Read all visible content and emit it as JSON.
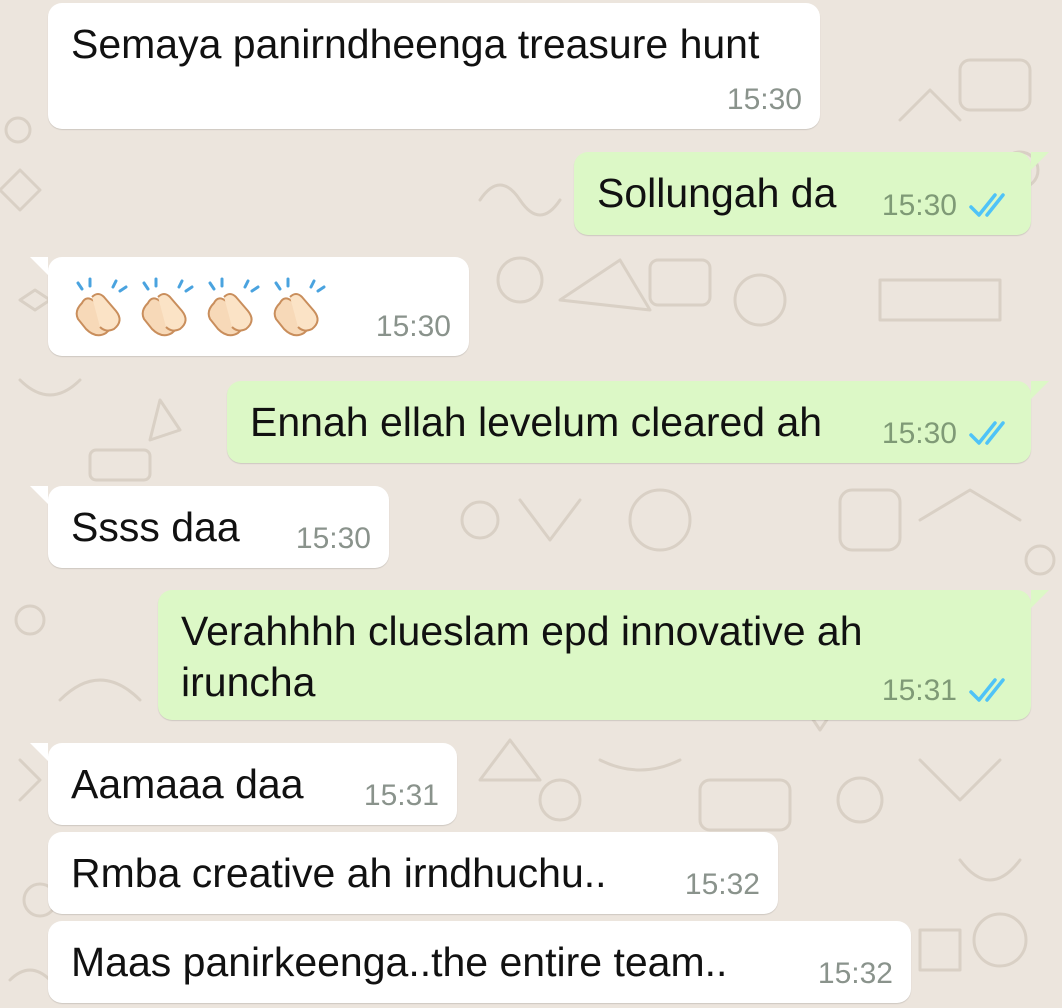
{
  "colors": {
    "incoming_bubble": "#ffffff",
    "outgoing_bubble": "#dcf8c6",
    "read_ticks": "#4fc3f7",
    "timestamp": "#8a938c",
    "wallpaper": "#ece5dd"
  },
  "messages": [
    {
      "direction": "incoming",
      "text": "Semaya panirndheenga treasure hunt",
      "time": "15:30"
    },
    {
      "direction": "outgoing",
      "text": "Sollungah da",
      "time": "15:30",
      "status_icon": "double-check-read-icon"
    },
    {
      "direction": "incoming",
      "emoji": [
        "👏",
        "👏",
        "👏",
        "👏"
      ],
      "emoji_icon": "clapping-hands-emoji",
      "time": "15:30"
    },
    {
      "direction": "outgoing",
      "text": "Ennah ellah levelum cleared ah",
      "time": "15:30",
      "status_icon": "double-check-read-icon"
    },
    {
      "direction": "incoming",
      "text": "Ssss daa",
      "time": "15:30"
    },
    {
      "direction": "outgoing",
      "text": "Verahhhh clueslam epd innovative ah iruncha",
      "time": "15:31",
      "status_icon": "double-check-read-icon"
    },
    {
      "direction": "incoming",
      "text": "Aamaaa daa",
      "time": "15:31"
    },
    {
      "direction": "incoming",
      "text": "Rmba creative ah irndhuchu..",
      "time": "15:32"
    },
    {
      "direction": "incoming",
      "text": "Maas panirkeenga..the entire team..",
      "time": "15:32"
    }
  ]
}
